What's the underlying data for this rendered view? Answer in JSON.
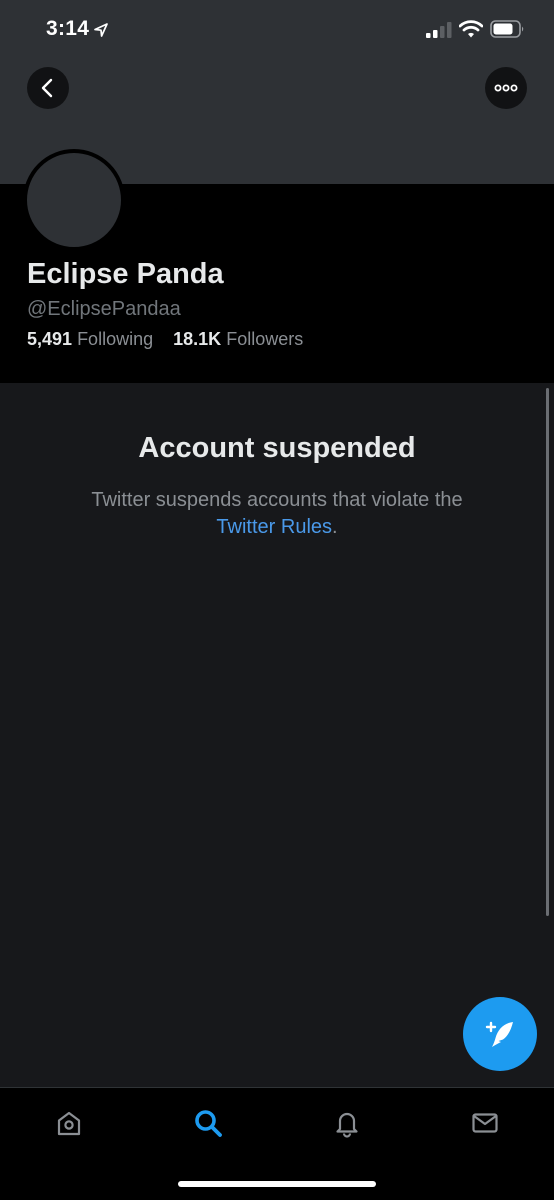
{
  "status_bar": {
    "time": "3:14"
  },
  "header": {
    "back_icon": "chevron-left-icon",
    "more_icon": "more-horizontal-icon"
  },
  "profile": {
    "display_name": "Eclipse Panda",
    "handle": "@EclipsePandaa",
    "following_count": "5,491",
    "following_label": "Following",
    "followers_count": "18.1K",
    "followers_label": "Followers"
  },
  "suspension": {
    "title": "Account suspended",
    "message": "Twitter suspends accounts that violate the",
    "link_text": "Twitter Rules",
    "trailing": "."
  },
  "tabs": [
    {
      "name": "home",
      "icon": "home-icon"
    },
    {
      "name": "search",
      "icon": "search-icon",
      "active": true
    },
    {
      "name": "notifications",
      "icon": "bell-icon"
    },
    {
      "name": "messages",
      "icon": "mail-icon"
    }
  ],
  "colors": {
    "accent": "#1d9bf0",
    "link": "#4a99e9",
    "background": "#17181b",
    "banner": "#2e3135"
  }
}
